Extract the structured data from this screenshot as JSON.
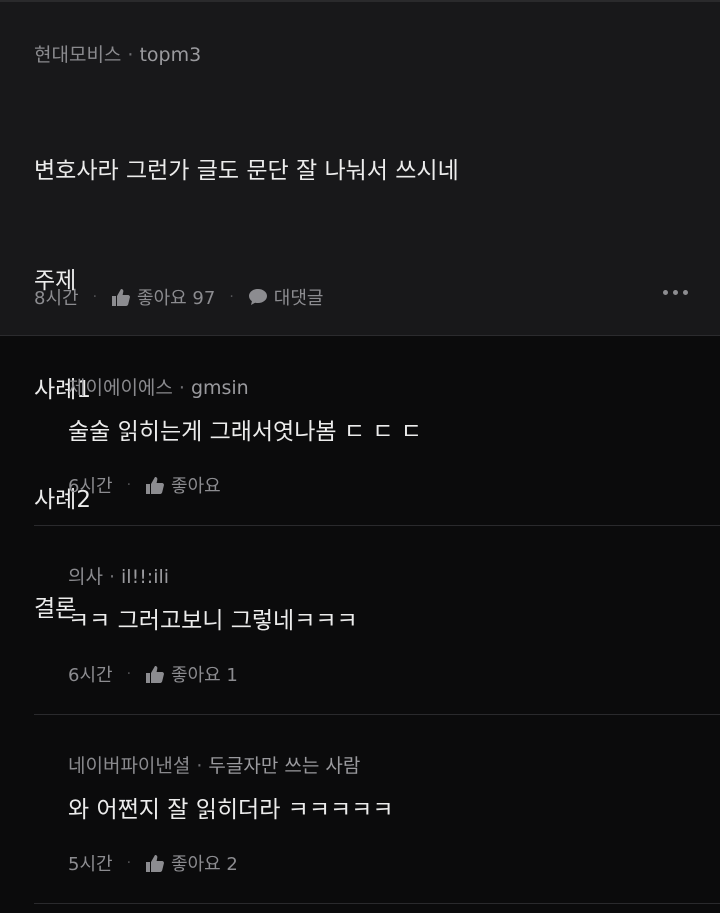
{
  "main": {
    "company": "현대모비스",
    "nickname": "topm3",
    "lines": [
      "변호사라 그런가 글도 문단 잘 나눠서 쓰시네",
      "주제",
      "사례1",
      "사례2",
      "결론"
    ],
    "time": "8시간",
    "like_label": "좋아요 97",
    "reply_label": "대댓글"
  },
  "replies": [
    {
      "company": "제이에이에스",
      "nickname": "gmsin",
      "text": "술술 읽히는게 그래서엿나봄 ㄷ ㄷ ㄷ",
      "time": "6시간",
      "like_label": "좋아요"
    },
    {
      "company": "의사",
      "nickname": "il!!:ili",
      "text": "ㅋㅋ 그러고보니 그렇네ㅋㅋㅋ",
      "time": "6시간",
      "like_label": "좋아요 1"
    },
    {
      "company": "네이버파이낸셜",
      "nickname": "두글자만 쓰는 사람",
      "text": "와 어쩐지 잘 읽히더라 ㅋㅋㅋㅋㅋ",
      "time": "5시간",
      "like_label": "좋아요 2"
    }
  ],
  "icons": {
    "like": "thumbs-up-icon",
    "reply": "speech-bubble-icon",
    "more": "more-dots-icon"
  },
  "colors": {
    "background": "#0b0b0c",
    "main_background": "#18181a",
    "meta": "#8a8a8e",
    "text": "#ececec"
  }
}
